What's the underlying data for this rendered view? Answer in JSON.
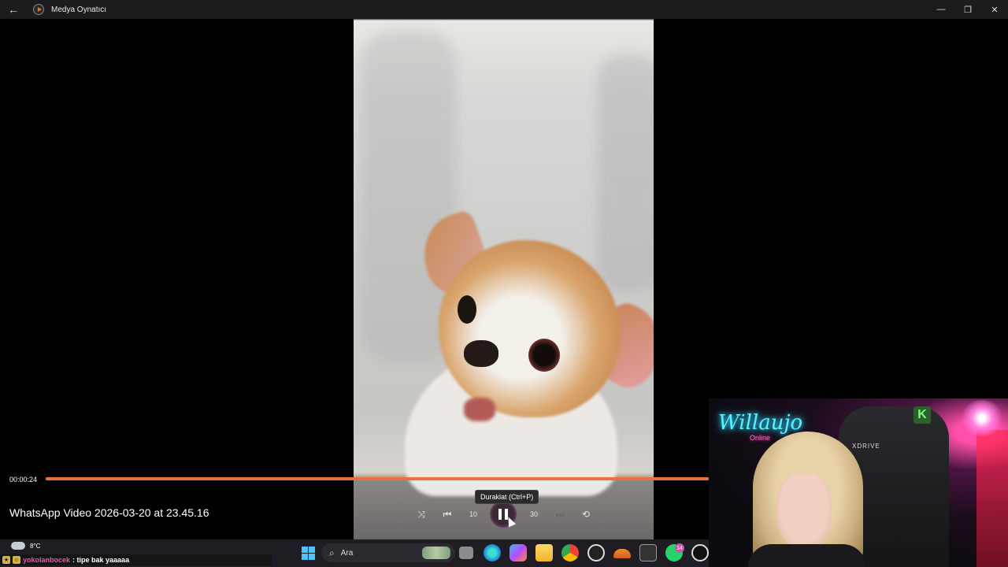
{
  "window": {
    "title": "Medya Oynatıcı",
    "back_glyph": "←",
    "minimize_glyph": "—",
    "maximize_glyph": "❐",
    "close_glyph": "✕"
  },
  "player": {
    "current_time": "00:00:24",
    "progress": 1.0,
    "video_title": "WhatsApp Video 2026-03-20 at 23.45.16",
    "tooltip": "Duraklat (Ctrl+P)",
    "skip_back_label": "10",
    "skip_forward_label": "30",
    "accent_color": "#e8723a"
  },
  "taskbar": {
    "weather_temp": "8°C",
    "search_placeholder": "Ara",
    "search_glyph": "⌕",
    "whatsapp_badge": "14",
    "icons": [
      "windows-start-icon",
      "search-icon",
      "task-view-icon",
      "edge-icon",
      "copilot-icon",
      "file-explorer-icon",
      "chrome-icon",
      "obs-icon",
      "cloud-app-icon",
      "terminal-icon",
      "whatsapp-icon",
      "media-player-icon"
    ]
  },
  "chat": {
    "username": "yokolanbocek",
    "message": ": tipe bak yaaaaa"
  },
  "webcam": {
    "neon_sign": "Willaujo",
    "neon_sub": "Online",
    "chair_brand": "XDRIVE",
    "k_logo": "K"
  }
}
